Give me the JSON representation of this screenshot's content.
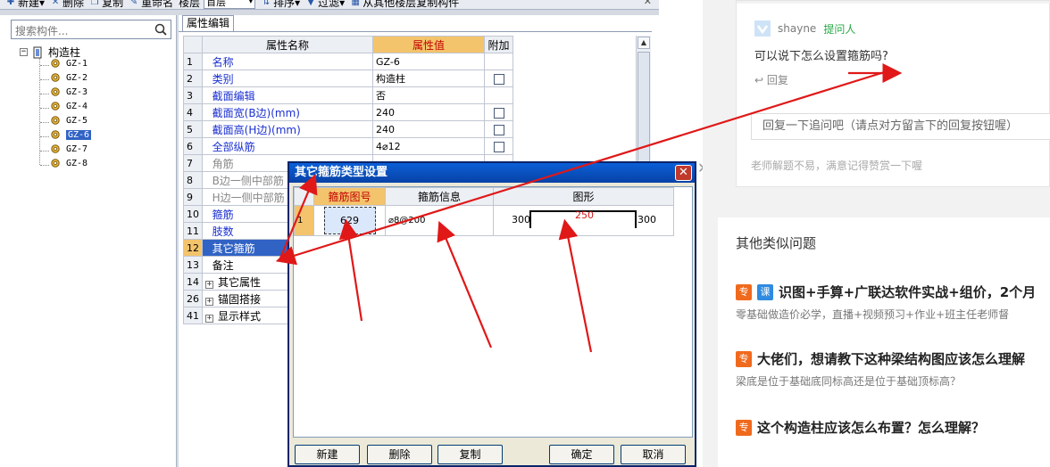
{
  "toolbar": {
    "new_label": "新建",
    "delete_label": "删除",
    "copy_label": "复制",
    "rename_label": "重命名",
    "floor_label": "楼层",
    "floor_value": "首层",
    "sort_label": "排序",
    "filter_label": "过滤",
    "copy_from_label": "从其他楼层复制构件"
  },
  "tree": {
    "search_placeholder": "搜索构件...",
    "root_label": "构造柱",
    "items": [
      "GZ-1",
      "GZ-2",
      "GZ-3",
      "GZ-4",
      "GZ-5",
      "GZ-6",
      "GZ-7",
      "GZ-8"
    ],
    "selected": "GZ-6"
  },
  "props": {
    "tab_label": "属性编辑",
    "col_name": "属性名称",
    "col_value": "属性值",
    "col_extra": "附加",
    "rows": [
      {
        "idx": "1",
        "name": "名称",
        "value": "GZ-6"
      },
      {
        "idx": "2",
        "name": "类别",
        "value": "构造柱"
      },
      {
        "idx": "3",
        "name": "截面编辑",
        "value": "否"
      },
      {
        "idx": "4",
        "name": "截面宽(B边)(mm)",
        "value": "240"
      },
      {
        "idx": "5",
        "name": "截面高(H边)(mm)",
        "value": "240"
      },
      {
        "idx": "6",
        "name": "全部纵筋",
        "value": "4⌀12"
      },
      {
        "idx": "7",
        "name": "角筋",
        "value": ""
      },
      {
        "idx": "8",
        "name": "B边一侧中部筋",
        "value": ""
      },
      {
        "idx": "9",
        "name": "H边一侧中部筋",
        "value": ""
      },
      {
        "idx": "10",
        "name": "箍筋",
        "value": ""
      },
      {
        "idx": "11",
        "name": "肢数",
        "value": ""
      },
      {
        "idx": "12",
        "name": "其它箍筋",
        "value": ""
      },
      {
        "idx": "13",
        "name": "备注",
        "value": ""
      },
      {
        "idx": "14",
        "name": "其它属性",
        "value": ""
      },
      {
        "idx": "26",
        "name": "锚固搭接",
        "value": ""
      },
      {
        "idx": "41",
        "name": "显示样式",
        "value": ""
      }
    ]
  },
  "dialog": {
    "title": "其它箍筋类型设置",
    "col_code": "箍筋图号",
    "col_info": "箍筋信息",
    "col_shape": "图形",
    "row": {
      "idx": "1",
      "code": "629",
      "info": "⌀8@200",
      "left": "300",
      "mid": "250",
      "right": "300"
    },
    "buttons": {
      "new": "新建",
      "delete": "删除",
      "copy": "复制",
      "ok": "确定",
      "cancel": "取消"
    }
  },
  "web": {
    "asker_name": "shayne",
    "asker_role": "提问人",
    "question": "可以说下怎么设置箍筋吗?",
    "reply_link": "回复",
    "reply_placeholder": "回复一下追问吧（请点对方留言下的回复按钮喔）",
    "tip": "老师解题不易，满意记得赞赏一下喔",
    "similar_title": "其他类似问题",
    "similar": [
      {
        "badges": [
          "专",
          "课"
        ],
        "title": "识图+手算+广联达软件实战+组价，2个月",
        "sub": "零基础做造价必学，直播+视频预习+作业+班主任老师督"
      },
      {
        "badges": [
          "专"
        ],
        "title": "大佬们，想请教下这种梁结构图应该怎么理解",
        "sub": "梁底是位于基础底同标高还是位于基础顶标高？"
      },
      {
        "badges": [
          "专"
        ],
        "title": "这个构造柱应该怎么布置？怎么理解？",
        "sub": ""
      }
    ]
  },
  "colors": {
    "accent_orange": "#f3c46b",
    "selection_blue": "#3163c5",
    "arrow_red": "#e01818",
    "role_green": "#25a745"
  }
}
